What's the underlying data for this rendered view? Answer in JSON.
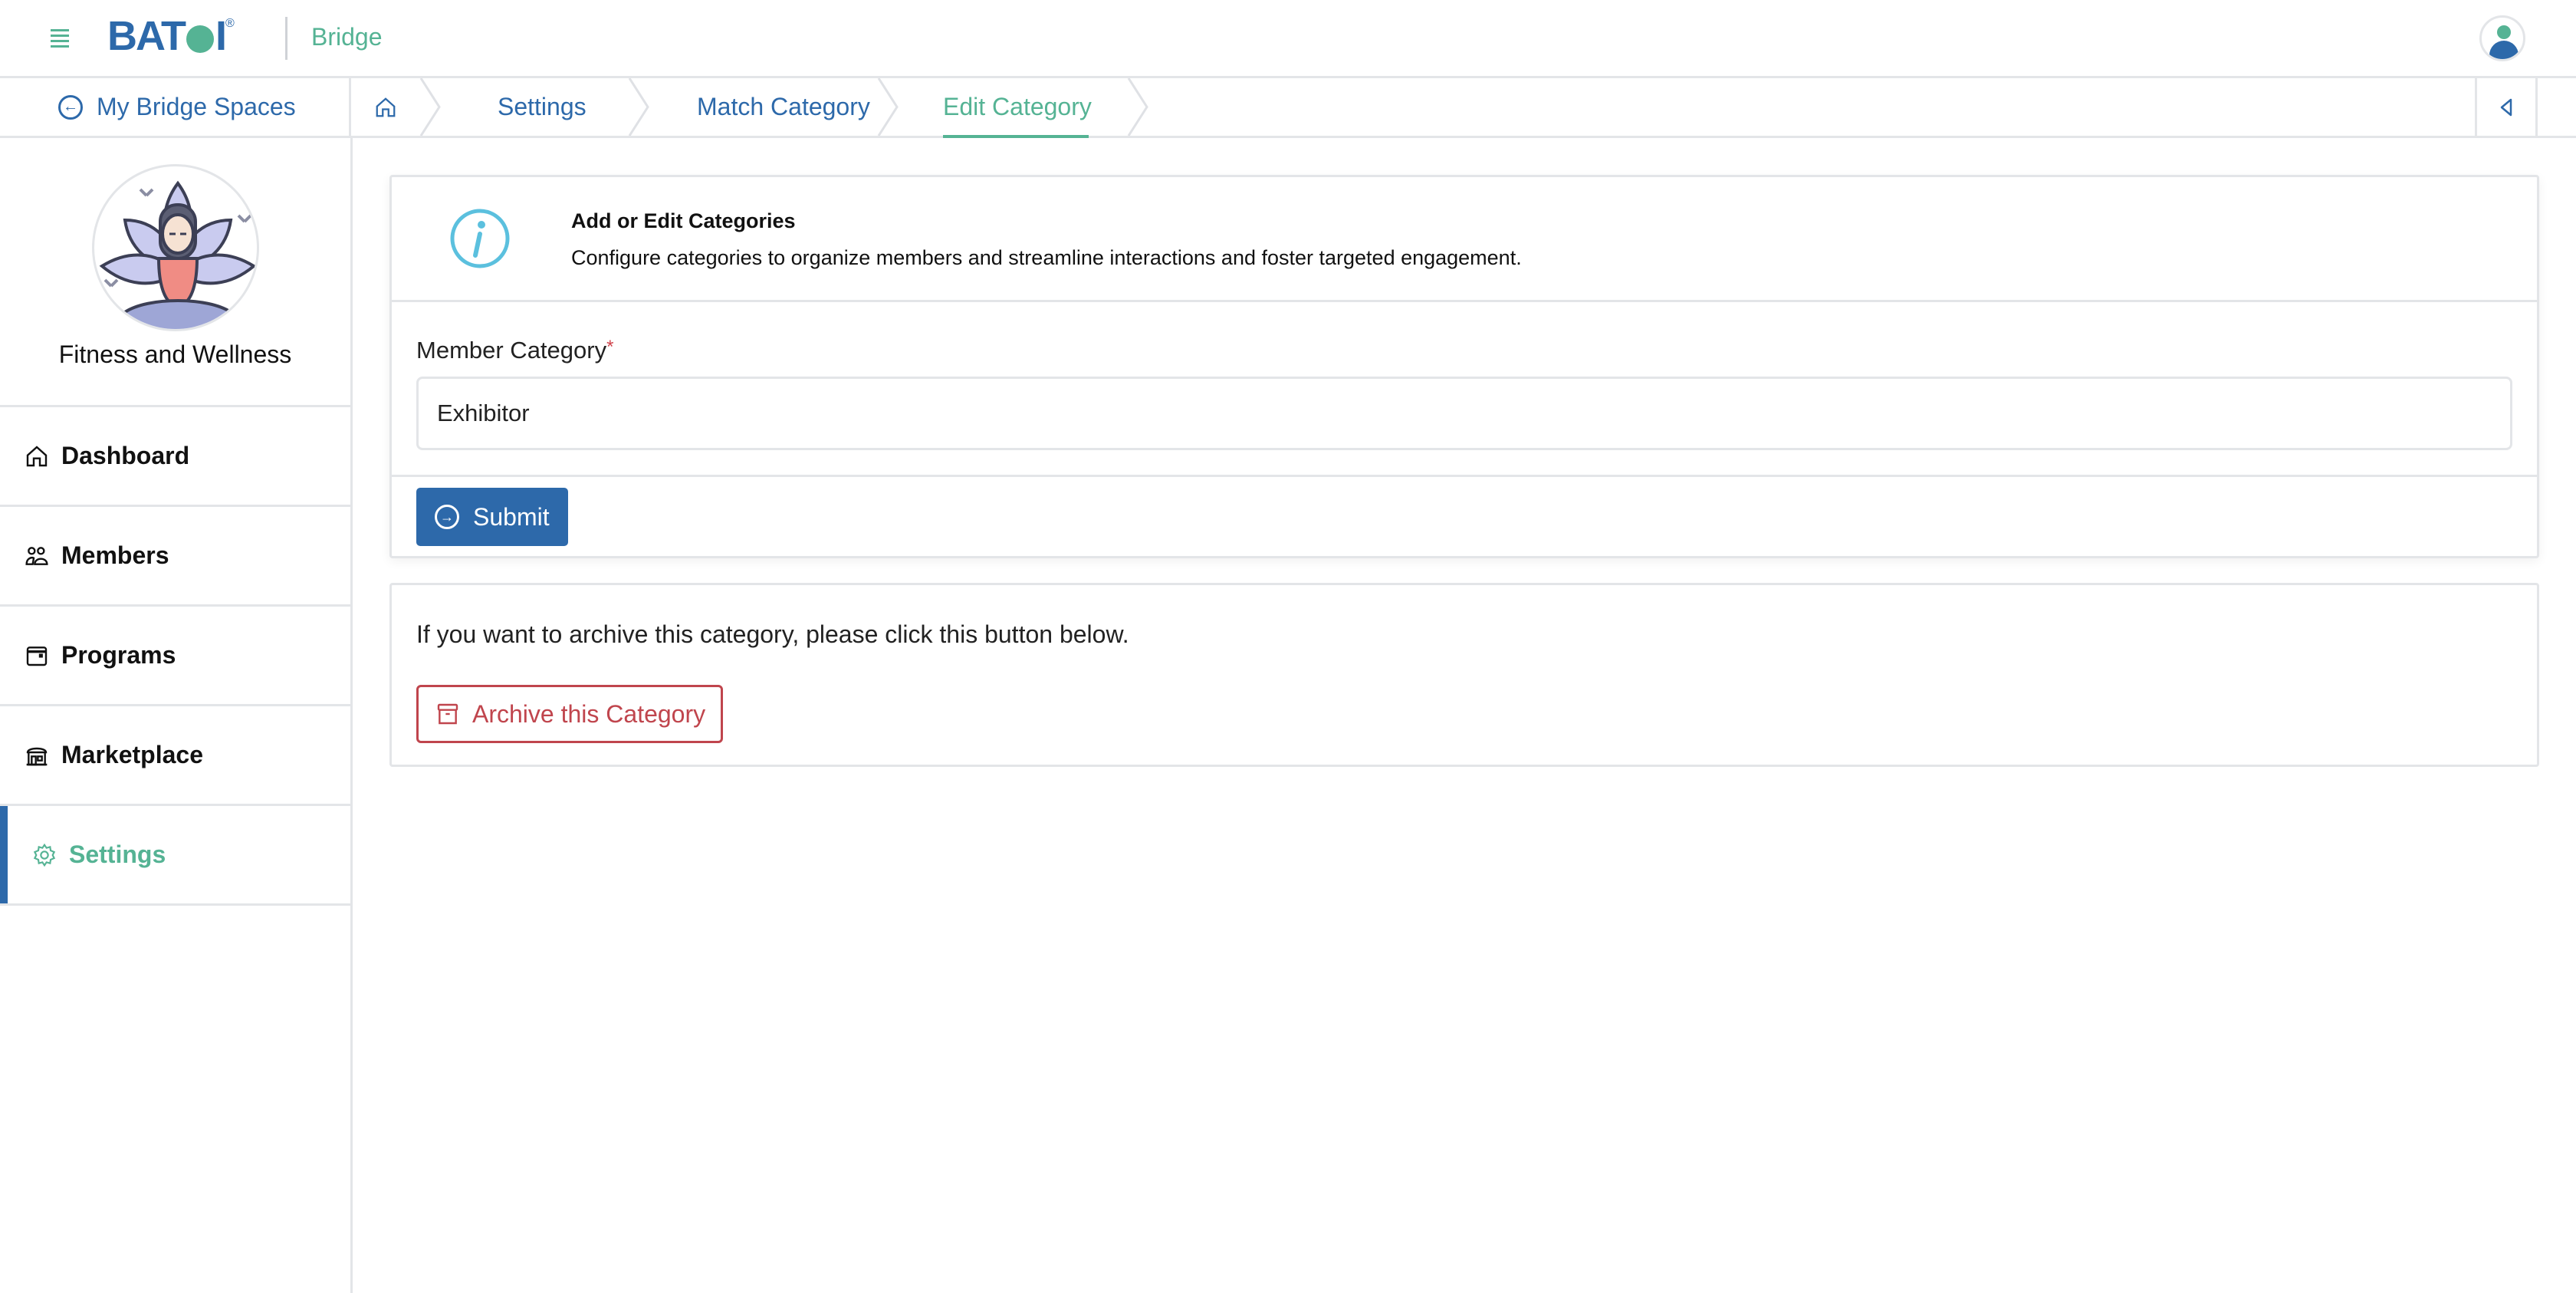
{
  "header": {
    "logo_text_left": "BAT",
    "logo_text_right": "I",
    "logo_reg": "®",
    "app_name": "Bridge"
  },
  "breadcrumb_bar": {
    "back_label": "My Bridge Spaces",
    "crumbs": [
      {
        "label": "Settings"
      },
      {
        "label": "Match Category"
      },
      {
        "label": "Edit Category",
        "active": true
      }
    ]
  },
  "sidebar": {
    "space_name": "Fitness and Wellness",
    "items": [
      {
        "label": "Dashboard",
        "icon": "home-icon"
      },
      {
        "label": "Members",
        "icon": "users-icon"
      },
      {
        "label": "Programs",
        "icon": "calendar-icon"
      },
      {
        "label": "Marketplace",
        "icon": "store-icon"
      },
      {
        "label": "Settings",
        "icon": "gear-icon",
        "active": true
      }
    ]
  },
  "main": {
    "info": {
      "title": "Add or Edit Categories",
      "description": "Configure categories to organize members and streamline interactions and foster targeted engagement."
    },
    "form": {
      "label": "Member Category",
      "required_mark": "*",
      "value": "Exhibitor",
      "submit_label": "Submit"
    },
    "archive": {
      "text": "If you want to archive this category, please click this button below.",
      "button_label": "Archive this Category"
    }
  },
  "colors": {
    "primary": "#2d69aa",
    "accent": "#55b394",
    "danger": "#c0454d",
    "info": "#5bc0de",
    "border": "#e3e5e8"
  }
}
